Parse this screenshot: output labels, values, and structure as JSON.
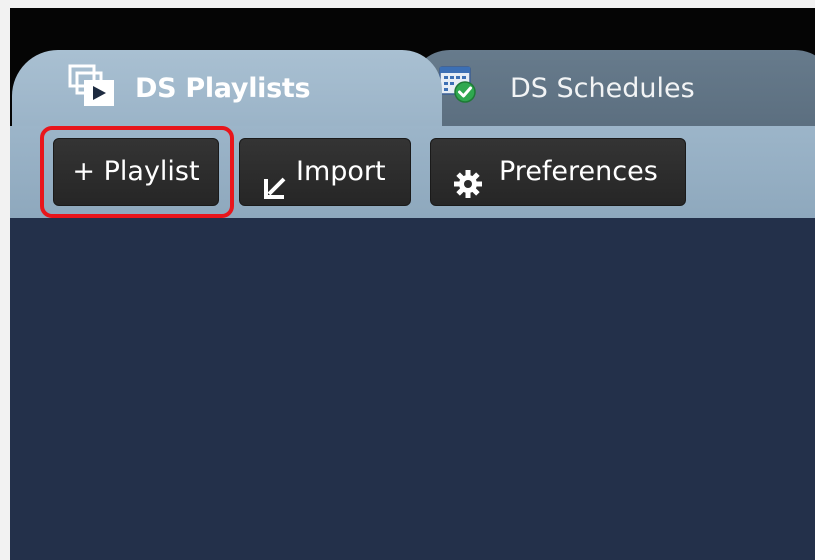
{
  "tabs": {
    "playlists": {
      "label": "DS Playlists",
      "icon": "playlist-stack-icon",
      "active": true
    },
    "schedules": {
      "label": "DS Schedules",
      "icon": "calendar-check-icon",
      "active": false
    }
  },
  "toolbar": {
    "add_playlist_label": "+ Playlist",
    "import_label": "Import",
    "import_icon": "import-arrow-icon",
    "preferences_label": "Preferences",
    "preferences_icon": "gear-icon",
    "highlighted_button": "add_playlist"
  },
  "colors": {
    "active_tab": "#a9c0d2",
    "inactive_tab": "#5b6e7f",
    "content_bg": "#23304a",
    "button_bg": "#2b2b2b",
    "highlight": "#e8151b"
  }
}
